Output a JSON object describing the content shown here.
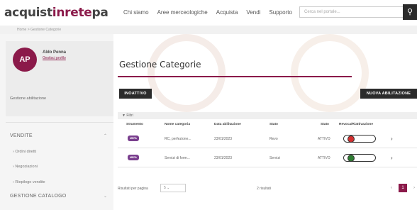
{
  "header": {
    "logo_main": "acquist",
    "logo_accent": "inrete",
    "logo_suffix": "pa",
    "nav": [
      "Chi siamo",
      "Aree merceologiche",
      "Acquista",
      "Vendi",
      "Supporto"
    ],
    "search_placeholder": "Cerca nel portale...",
    "search_icon": "search-icon"
  },
  "breadcrumb": "Home > Gestione Categorie",
  "user": {
    "initials": "AP",
    "name": "Aldo Penna",
    "profile_link": "Gestisci profilo",
    "manage_link": "Gestione abilitazione"
  },
  "menu": {
    "sections": [
      {
        "title": "VENDITE",
        "items": [
          "Ordini diretti",
          "Negoziazioni",
          "Riepilogo vendite"
        ]
      },
      {
        "title": "GESTIONE CATALOGO",
        "items": []
      }
    ]
  },
  "main": {
    "title": "Gestione Categorie",
    "inactive_button": "INOATTIVO",
    "new_button": "NUOVA ABILITAZIONE",
    "filter_label": "Filtri",
    "columns": [
      "Strumento",
      "Nome categoria",
      "Data abilitazione",
      "Stato",
      "Stato",
      "Revoca/Riattivazione"
    ],
    "rows": [
      {
        "chip": "MEPA",
        "name": "RC, perfezione...",
        "date": "23/01/2023",
        "state": "Revo",
        "status": "ATTIVO",
        "toggle": "off",
        "toggle_color": "#d32f2f"
      },
      {
        "chip": "MEPA",
        "name": "Servizi di form...",
        "date": "23/01/2023",
        "state": "Servizi",
        "status": "ATTIVO",
        "toggle": "on",
        "toggle_color": "#2e7d32"
      }
    ],
    "rows_per_page_label": "Risultati per pagina",
    "rows_per_page_value": "5",
    "count": "2 risultati",
    "pages": [
      "‹",
      "1",
      "›"
    ],
    "current_page": "1"
  },
  "colors": {
    "brand": "#8b1a4a",
    "dark": "#2b2b2b"
  }
}
